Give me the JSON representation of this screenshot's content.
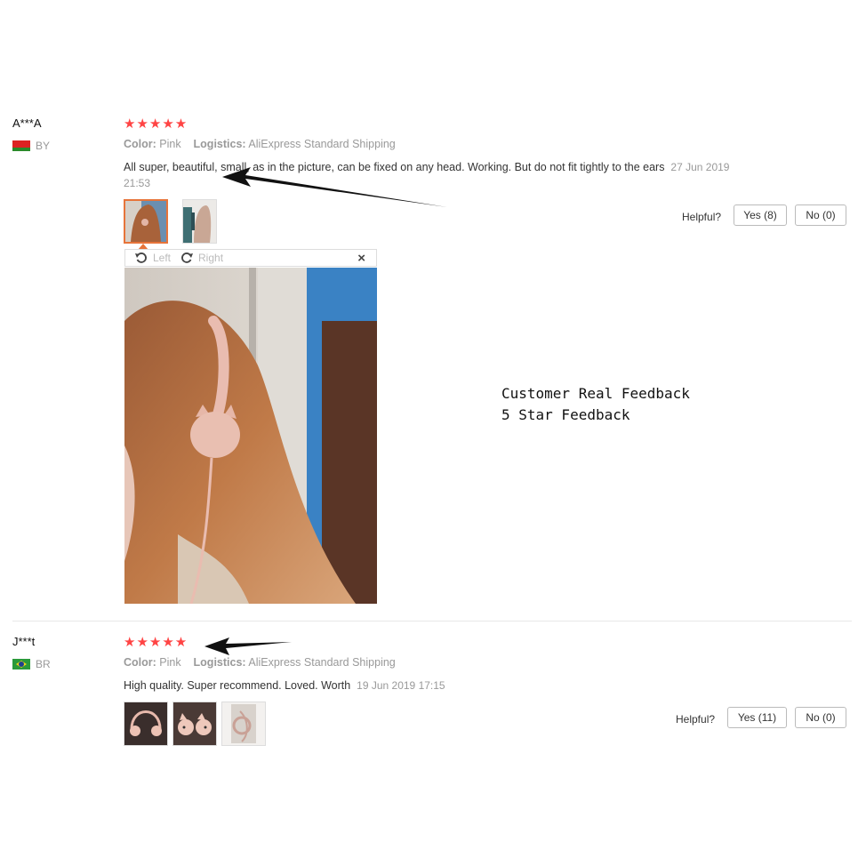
{
  "reviews": [
    {
      "user": "A***A",
      "country": "BY",
      "stars": "★★★★★",
      "rating": 5,
      "color_label": "Color:",
      "color_value": "Pink",
      "logistics_label": "Logistics:",
      "logistics_value": "AliExpress Standard Shipping",
      "text": "All super, beautiful, small, as in the picture, can be fixed on any head. Working. But do not fit tightly to the ears",
      "date": "27 Jun 2019 21:53",
      "helpful_label": "Helpful?",
      "yes_label": "Yes (8)",
      "no_label": "No (0)"
    },
    {
      "user": "J***t",
      "country": "BR",
      "stars": "★★★★★",
      "rating": 5,
      "color_label": "Color:",
      "color_value": "Pink",
      "logistics_label": "Logistics:",
      "logistics_value": "AliExpress Standard Shipping",
      "text": "High quality. Super recommend. Loved. Worth",
      "date": "19 Jun 2019 17:15",
      "helpful_label": "Helpful?",
      "yes_label": "Yes (11)",
      "no_label": "No (0)"
    }
  ],
  "viewer": {
    "rotate_left_label": "Left",
    "rotate_right_label": "Right",
    "close_label": "×"
  },
  "overlay": {
    "line1": "Customer Real Feedback",
    "line2": "5 Star Feedback"
  },
  "colors": {
    "star": "#ff4444",
    "accent_border": "#e7743a",
    "meta_text": "#999999"
  }
}
